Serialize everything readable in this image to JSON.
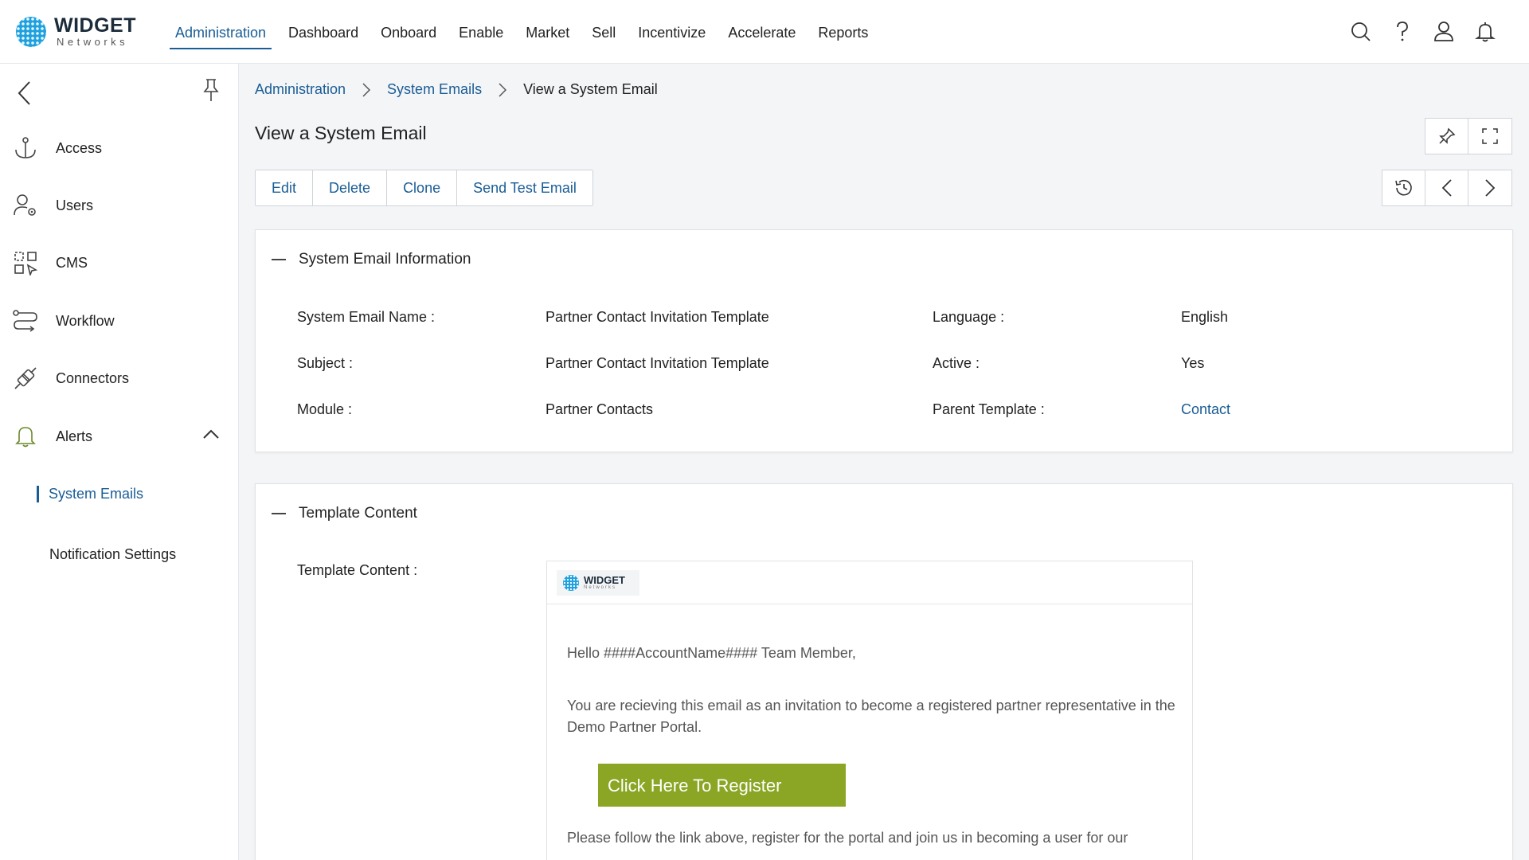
{
  "brand": {
    "name": "WIDGET",
    "sub": "Networks",
    "color": "#1ea1de"
  },
  "nav": {
    "items": [
      "Administration",
      "Dashboard",
      "Onboard",
      "Enable",
      "Market",
      "Sell",
      "Incentivize",
      "Accelerate",
      "Reports"
    ],
    "active": "Administration"
  },
  "top_icons": [
    "search-icon",
    "help-icon",
    "user-icon",
    "bell-icon"
  ],
  "sidebar": {
    "items": [
      {
        "label": "Access",
        "icon": "anchor-icon"
      },
      {
        "label": "Users",
        "icon": "user-settings-icon"
      },
      {
        "label": "CMS",
        "icon": "cms-grid-icon"
      },
      {
        "label": "Workflow",
        "icon": "workflow-icon"
      },
      {
        "label": "Connectors",
        "icon": "plug-icon"
      },
      {
        "label": "Alerts",
        "icon": "bell-icon"
      }
    ],
    "sub_items": [
      "System Emails",
      "Notification Settings"
    ],
    "active_sub": "System Emails"
  },
  "breadcrumb": [
    "Administration",
    "System Emails",
    "View a System Email"
  ],
  "page_title": "View a System Email",
  "actions": [
    "Edit",
    "Delete",
    "Clone",
    "Send Test Email"
  ],
  "info": {
    "title": "System Email Information",
    "fields": {
      "name_label": "System Email Name :",
      "name_value": "Partner Contact Invitation Template",
      "subject_label": "Subject :",
      "subject_value": "Partner Contact Invitation Template",
      "module_label": "Module :",
      "module_value": "Partner Contacts",
      "language_label": "Language :",
      "language_value": "English",
      "active_label": "Active :",
      "active_value": "Yes",
      "parent_label": "Parent Template :",
      "parent_value": "Contact"
    }
  },
  "template": {
    "title": "Template Content",
    "label": "Template Content :",
    "email": {
      "logo_title": "WIDGET",
      "logo_sub": "Networks",
      "greeting": "Hello ####AccountName#### Team Member,",
      "intro": "You are recieving this email as an invitation to become a registered partner representative in the Demo Partner Portal.",
      "button": "Click Here To Register",
      "button_color": "#8aa624",
      "follow": "Please follow the link above, register for the portal and join us in becoming a user for our"
    }
  },
  "colors": {
    "link": "#1a5d96"
  }
}
